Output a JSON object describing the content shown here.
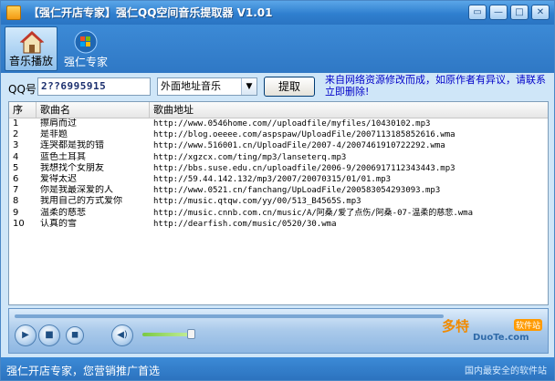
{
  "window": {
    "title": "【强仁开店专家】强仁QQ空间音乐提取器 V1.01",
    "controls": [
      "skin-icon",
      "minimize-icon",
      "maximize-icon",
      "close-icon"
    ]
  },
  "toolbar": {
    "music_label": "音乐播放",
    "expert_label": "强仁专家"
  },
  "controls": {
    "qq_label": "QQ号:",
    "qq_value": "2??6995915",
    "select_value": "外面地址音乐",
    "extract_label": "提取",
    "notice": "来自网络资源修改而成，如原作者有异议，请联系立即删除!"
  },
  "list": {
    "headers": [
      "序",
      "歌曲名",
      "歌曲地址"
    ],
    "rows": [
      {
        "no": "1",
        "name": "擦肩而过",
        "url": "http://www.0546home.com//uploadfile/myfiles/10430102.mp3"
      },
      {
        "no": "2",
        "name": "是非题",
        "url": "http://blog.oeeee.com/aspspaw/UploadFile/2007113185852616.wma"
      },
      {
        "no": "3",
        "name": "连哭都是我的错",
        "url": "http://www.516001.cn/UploadFile/2007-4/2007461910722292.wma"
      },
      {
        "no": "4",
        "name": "蓝色土耳其",
        "url": "http://xgzcx.com/ting/mp3/lanseterq.mp3"
      },
      {
        "no": "5",
        "name": "我想找个女朋友",
        "url": "http://bbs.suse.edu.cn/uploadfile/2006-9/2006917112343443.mp3"
      },
      {
        "no": "6",
        "name": "爱得太迟",
        "url": "http://59.44.142.132/mp3/2007/20070315/01/01.mp3"
      },
      {
        "no": "7",
        "name": "你是我最深爱的人",
        "url": "http://www.0521.cn/fanchang/UpLoadFile/200583054293093.mp3"
      },
      {
        "no": "8",
        "name": "我用自己的方式爱你",
        "url": "http://music.qtqw.com/yy/00/513_B4565S.mp3"
      },
      {
        "no": "9",
        "name": "温柔的慈悲",
        "url": "http://music.cnnb.com.cn/music/A/阿桑/爱了点伤/阿桑-07-温柔的慈悲.wma"
      },
      {
        "no": "10",
        "name": "认真的雪",
        "url": "http://dearfish.com/music/0520/30.wma"
      }
    ]
  },
  "player": {
    "buttons": [
      "play-icon",
      "stop-icon",
      "mute-icon",
      "volume-icon"
    ],
    "volume_fraction": 0.95
  },
  "watermark": {
    "logo": "多特",
    "tag": "软件站",
    "site": "DuoTe.com",
    "slogan": "国内最安全的软件站"
  },
  "status": {
    "text": "强仁开店专家，您营销推广首选"
  },
  "colors": {
    "chrome_blue": "#2f78c5",
    "notice_blue": "#0000c8",
    "watermark_orange": "#f08a00"
  }
}
